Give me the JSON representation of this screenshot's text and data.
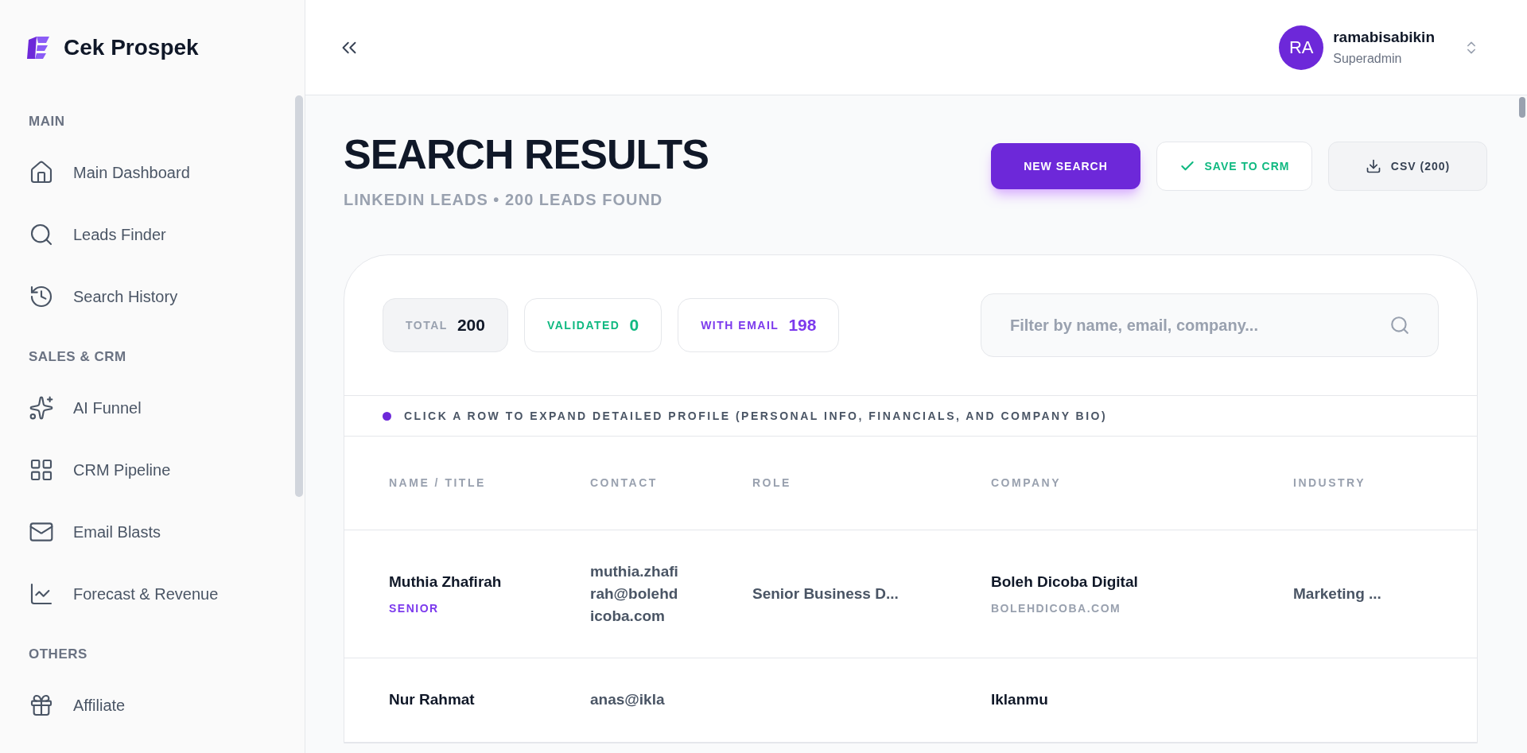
{
  "sidebar": {
    "brand": "Cek Prospek",
    "sections": [
      {
        "title": "MAIN",
        "items": [
          {
            "label": "Main Dashboard"
          },
          {
            "label": "Leads Finder"
          },
          {
            "label": "Search History"
          }
        ]
      },
      {
        "title": "SALES & CRM",
        "items": [
          {
            "label": "AI Funnel"
          },
          {
            "label": "CRM Pipeline"
          },
          {
            "label": "Email Blasts"
          },
          {
            "label": "Forecast & Revenue"
          }
        ]
      },
      {
        "title": "OTHERS",
        "items": [
          {
            "label": "Affiliate"
          }
        ]
      }
    ]
  },
  "header": {
    "avatar": "RA",
    "user_name": "ramabisabikin",
    "user_role": "Superadmin"
  },
  "page": {
    "title": "SEARCH RESULTS",
    "subtitle": "LINKEDIN LEADS • 200 LEADS FOUND",
    "buttons": [
      {
        "label": "NEW SEARCH",
        "kind": "primary"
      },
      {
        "label": "SAVE TO CRM",
        "kind": "save"
      },
      {
        "label": "CSV (200)",
        "kind": "download"
      }
    ]
  },
  "stats": [
    {
      "label": "TOTAL",
      "value": "200",
      "kind": "total"
    },
    {
      "label": "VALIDATED",
      "value": "0",
      "kind": "validated"
    },
    {
      "label": "WITH EMAIL",
      "value": "198",
      "kind": "email"
    }
  ],
  "filter": {
    "placeholder": "Filter by name, email, company..."
  },
  "hint": "CLICK A ROW TO EXPAND DETAILED PROFILE (PERSONAL INFO, FINANCIALS, AND COMPANY BIO)",
  "table": {
    "columns": [
      "NAME / TITLE",
      "CONTACT",
      "ROLE",
      "COMPANY",
      "INDUSTRY"
    ],
    "rows": [
      {
        "name": "Muthia Zhafirah",
        "level": "SENIOR",
        "email": "muthia.zhafirah@bolehdicoba.com",
        "role": "Senior Business D...",
        "company": "Boleh Dicoba Digital",
        "domain": "BOLEHDICOBA.COM",
        "industry": "Marketing ..."
      },
      {
        "name": "Nur Rahmat",
        "email": "anas@ikla",
        "company": "Iklanmu"
      }
    ]
  }
}
